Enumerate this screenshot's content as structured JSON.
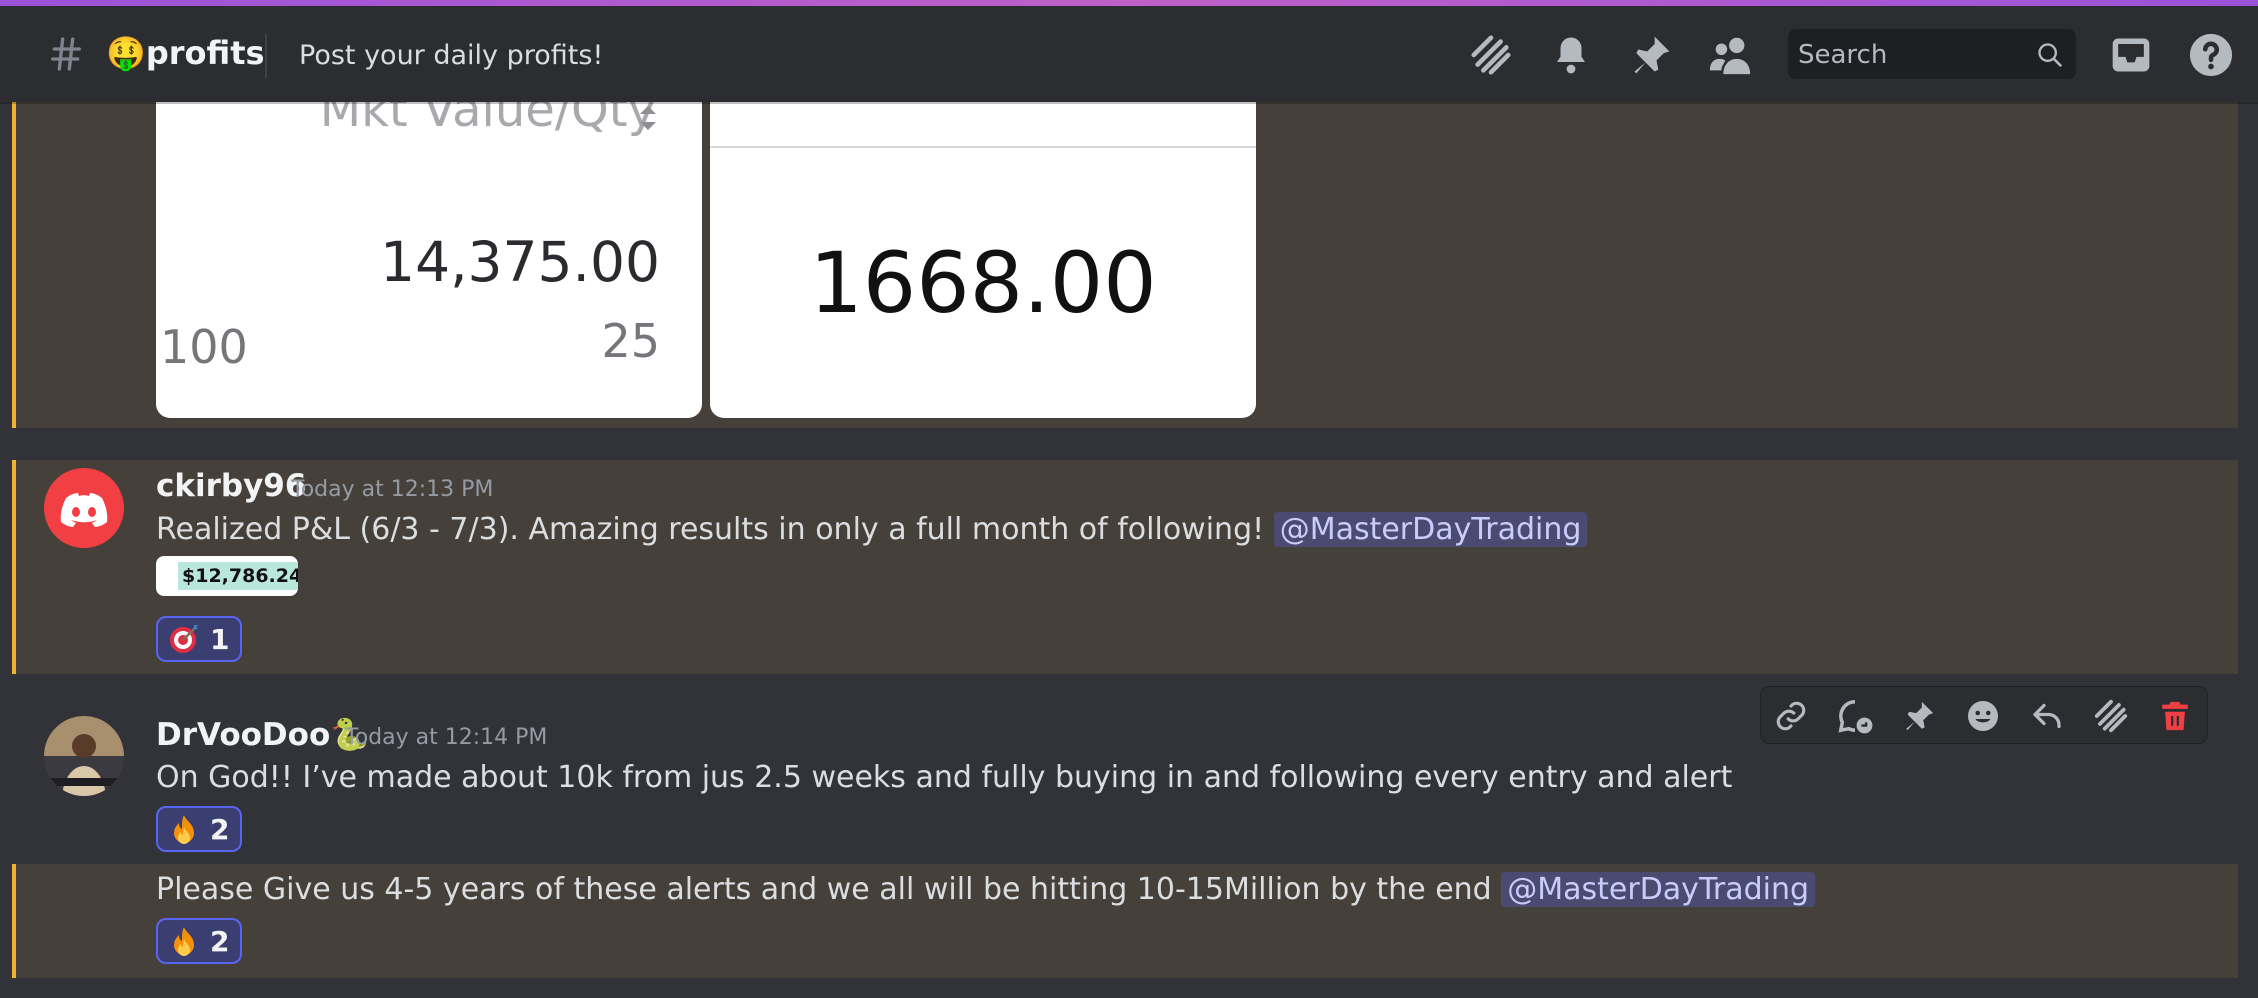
{
  "header": {
    "channel_emoji": "🤑",
    "channel_name": "profits",
    "topic": "Post your daily profits!",
    "search_placeholder": "Search"
  },
  "embed": {
    "left_card": {
      "column_header": "Mkt Value/Qty",
      "mkt_value": "14,375.00",
      "qty_left": "100",
      "qty_right": "25"
    },
    "right_card": {
      "value": "1668.00"
    }
  },
  "messages": [
    {
      "username": "ckirby96",
      "timestamp": "Today at 12:13 PM",
      "text": "Realized P&L (6/3 - 7/3). Amazing results in only a full month of following!",
      "mention": "@MasterDayTrading",
      "attachment_value": "$12,786.24",
      "reaction": {
        "emoji": "direct-hit",
        "count": "1"
      }
    },
    {
      "username": "DrVooDoo",
      "username_emoji": "🐍",
      "timestamp": "Today at 12:14 PM",
      "text": "On God!! I’ve made about 10k from jus 2.5 weeks and fully buying in and following every entry and alert",
      "reaction": {
        "emoji": "fire",
        "count": "2"
      }
    },
    {
      "text": "Please Give us 4-5 years of these alerts and we all will be hitting 10-15Million by the end",
      "mention": "@MasterDayTrading",
      "reaction": {
        "emoji": "fire",
        "count": "2"
      }
    }
  ],
  "colors": {
    "background": "#313338",
    "header": "#2b2d31",
    "highlight": "#46403a",
    "highlight_bar": "#f0b232",
    "mention_bg": "rgba(88,101,242,0.3)",
    "reaction_border": "#5865f2",
    "delete": "#f23f43"
  }
}
